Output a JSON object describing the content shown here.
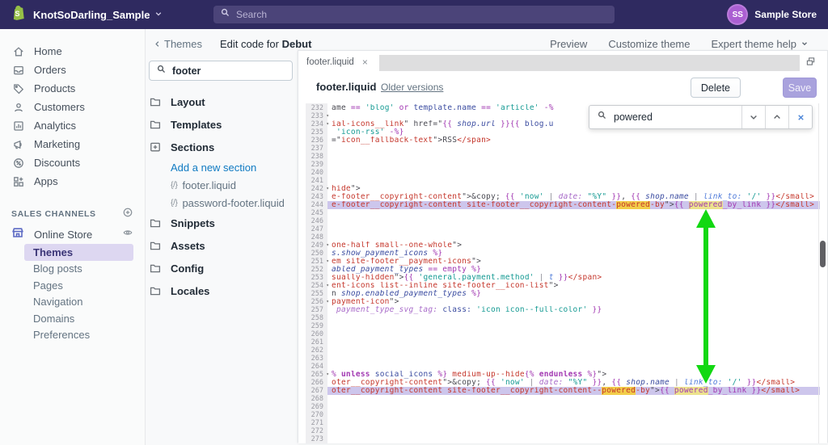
{
  "topbar": {
    "store_name": "KnotSoDarling_Sample",
    "search_placeholder": "Search",
    "avatar_initials": "SS",
    "account_name": "Sample Store"
  },
  "header": {
    "back_label": "Themes",
    "title_prefix": "Edit code for ",
    "title_theme": "Debut",
    "actions": [
      {
        "label": "Preview"
      },
      {
        "label": "Customize theme"
      },
      {
        "label": "Expert theme help",
        "caret": true
      }
    ]
  },
  "sidebar": {
    "items": [
      {
        "label": "Home",
        "icon": "home-icon"
      },
      {
        "label": "Orders",
        "icon": "orders-icon"
      },
      {
        "label": "Products",
        "icon": "products-icon"
      },
      {
        "label": "Customers",
        "icon": "customers-icon"
      },
      {
        "label": "Analytics",
        "icon": "analytics-icon"
      },
      {
        "label": "Marketing",
        "icon": "marketing-icon"
      },
      {
        "label": "Discounts",
        "icon": "discounts-icon"
      },
      {
        "label": "Apps",
        "icon": "apps-icon"
      }
    ],
    "sales_channels_label": "SALES CHANNELS",
    "online_store_label": "Online Store",
    "online_store_subitems": [
      {
        "label": "Themes",
        "active": true
      },
      {
        "label": "Blog posts"
      },
      {
        "label": "Pages"
      },
      {
        "label": "Navigation"
      },
      {
        "label": "Domains"
      },
      {
        "label": "Preferences"
      }
    ]
  },
  "file_panel": {
    "search_value": "footer",
    "items": [
      {
        "type": "folder",
        "icon": "folder-icon",
        "label": "Layout"
      },
      {
        "type": "folder",
        "icon": "folder-icon",
        "label": "Templates"
      },
      {
        "type": "folder",
        "icon": "folder-plus-icon",
        "label": "Sections"
      },
      {
        "type": "link",
        "label": "Add a new section"
      },
      {
        "type": "file",
        "prefix": "{/}",
        "label": "footer.liquid"
      },
      {
        "type": "file",
        "prefix": "{/}",
        "label": "password-footer.liquid"
      },
      {
        "type": "folder",
        "icon": "folder-icon",
        "label": "Snippets"
      },
      {
        "type": "folder",
        "icon": "folder-icon",
        "label": "Assets"
      },
      {
        "type": "folder",
        "icon": "folder-icon",
        "label": "Config"
      },
      {
        "type": "folder",
        "icon": "folder-icon",
        "label": "Locales"
      }
    ]
  },
  "editor": {
    "tab_label": "footer.liquid",
    "filename": "footer.liquid",
    "older_versions_label": "Older versions",
    "delete_label": "Delete",
    "save_label": "Save",
    "find_value": "powered"
  },
  "annotation_arrow": {
    "color": "#12d812",
    "from_line": 244,
    "to_line": 267
  },
  "code": {
    "start": 232,
    "end": 273,
    "fold_lines": [
      233,
      234,
      242,
      249,
      251,
      254,
      256,
      265
    ],
    "hl_lines": [
      244,
      267
    ],
    "lines": {
      "232": [
        [
          "d",
          "ame "
        ],
        [
          "p",
          "== "
        ],
        [
          "t",
          "'blog' "
        ],
        [
          "p",
          "or "
        ],
        [
          "n",
          "template.name "
        ],
        [
          "p",
          "== "
        ],
        [
          "t",
          "'article' "
        ],
        [
          "p",
          "-%"
        ]
      ],
      "234": [
        [
          "r",
          "ial-icons__link"
        ],
        [
          "d",
          "\" href=\""
        ],
        [
          "p",
          "{{ "
        ],
        [
          "ni",
          "shop.url"
        ],
        [
          "p",
          " }}{{ "
        ],
        [
          "n",
          "blog.u"
        ]
      ],
      "235": [
        [
          "t",
          " 'icon-rss'"
        ],
        [
          "p",
          " -%}"
        ]
      ],
      "236": [
        [
          "d",
          "=\""
        ],
        [
          "r",
          "icon__fallback-text"
        ],
        [
          "d",
          "\">RSS"
        ],
        [
          "r",
          "</span>"
        ]
      ],
      "242": [
        [
          "r",
          "hide"
        ],
        [
          "d",
          "\">"
        ]
      ],
      "243": [
        [
          "r",
          "e-footer__copyright-content"
        ],
        [
          "d",
          "\">&copy; "
        ],
        [
          "p",
          "{{ "
        ],
        [
          "t",
          "'now'"
        ],
        [
          "g",
          " | "
        ],
        [
          "pi",
          "date:"
        ],
        [
          "t",
          " \"%Y\""
        ],
        [
          "p",
          " }}"
        ],
        [
          "d",
          ", "
        ],
        [
          "p",
          "{{ "
        ],
        [
          "ni",
          "shop.name"
        ],
        [
          "g",
          " | "
        ],
        [
          "bi",
          "link_to:"
        ],
        [
          "t",
          " '/'"
        ],
        [
          "p",
          " }}"
        ],
        [
          "r",
          "</small>"
        ]
      ],
      "244": [
        [
          "r",
          "e-footer__copyright-content site-footer__copyright-content-"
        ],
        [
          "r hl",
          "powered"
        ],
        [
          "r",
          "-by"
        ],
        [
          "d",
          "\">"
        ],
        [
          "p",
          "{{ "
        ],
        [
          "p hl2",
          "powered"
        ],
        [
          "p",
          "_by_link"
        ],
        [
          "p",
          " }}"
        ],
        [
          "r",
          "</small>"
        ]
      ],
      "249": [
        [
          "r",
          "one-half small--one-whole"
        ],
        [
          "d",
          "\">"
        ]
      ],
      "250": [
        [
          "ni",
          "s.show_payment_icons"
        ],
        [
          "p",
          " %}"
        ]
      ],
      "251": [
        [
          "r",
          "em site-footer__payment-icons"
        ],
        [
          "d",
          "\">"
        ]
      ],
      "252": [
        [
          "ni",
          "abled_payment_types"
        ],
        [
          "p",
          " == empty %}"
        ]
      ],
      "253": [
        [
          "r",
          "sually-hidden"
        ],
        [
          "d",
          "\">"
        ],
        [
          "p",
          "{{ "
        ],
        [
          "t",
          "'general.payment.method'"
        ],
        [
          "g",
          " | "
        ],
        [
          "bi",
          "t"
        ],
        [
          "p",
          " }}"
        ],
        [
          "r",
          "</span>"
        ]
      ],
      "254": [
        [
          "r",
          "ent-icons list--inline site-footer__icon-list"
        ],
        [
          "d",
          "\">"
        ]
      ],
      "255": [
        [
          "d",
          "n "
        ],
        [
          "ni",
          "shop.enabled_payment_types"
        ],
        [
          "p",
          " %}"
        ]
      ],
      "256": [
        [
          "r",
          "payment-icon"
        ],
        [
          "d",
          "\">"
        ]
      ],
      "257": [
        [
          "pi",
          " payment_type_svg_tag:"
        ],
        [
          "n",
          " class:"
        ],
        [
          "t",
          " 'icon icon--full-color'"
        ],
        [
          "p",
          " }}"
        ]
      ],
      "265": [
        [
          "p",
          "% "
        ],
        [
          "pb",
          "unless"
        ],
        [
          "n",
          " social_icons"
        ],
        [
          "p",
          " %}"
        ],
        [
          "r",
          " medium-up--hide"
        ],
        [
          "p",
          "{% "
        ],
        [
          "pb",
          "endunless"
        ],
        [
          "p",
          " %}"
        ],
        [
          "d",
          "\">"
        ]
      ],
      "266": [
        [
          "r",
          "oter__copyright-content"
        ],
        [
          "d",
          "\">&copy; "
        ],
        [
          "p",
          "{{ "
        ],
        [
          "t",
          "'now'"
        ],
        [
          "g",
          " | "
        ],
        [
          "pi",
          "date:"
        ],
        [
          "t",
          " \"%Y\""
        ],
        [
          "p",
          " }}"
        ],
        [
          "d",
          ", "
        ],
        [
          "p",
          "{{ "
        ],
        [
          "ni",
          "shop.name"
        ],
        [
          "g",
          " | "
        ],
        [
          "bi",
          "link_to:"
        ],
        [
          "t",
          " '/'"
        ],
        [
          "p",
          " }}"
        ],
        [
          "r",
          "</small>"
        ]
      ],
      "267": [
        [
          "r",
          "oter__copyright-content site-footer__copyright-content--"
        ],
        [
          "r hl",
          "powered"
        ],
        [
          "r",
          "-by"
        ],
        [
          "d",
          "\">"
        ],
        [
          "p",
          "{{ "
        ],
        [
          "p hl2",
          "powered"
        ],
        [
          "p",
          "_by_link"
        ],
        [
          "p",
          " }}"
        ],
        [
          "r",
          "</small>"
        ]
      ]
    }
  }
}
